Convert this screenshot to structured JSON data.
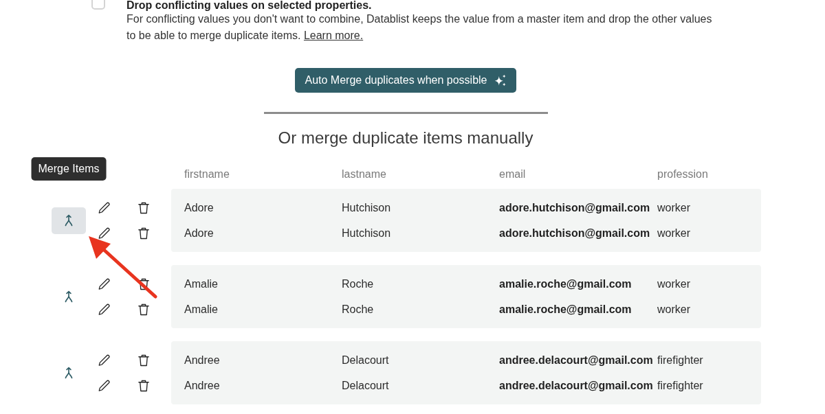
{
  "option": {
    "checked": false,
    "title": "Drop conflicting values on selected properties.",
    "description": "For conflicting values you don't want to combine, Datablist keeps the value from a master item and drop the other values to be able to merge duplicate items.",
    "link": "Learn more."
  },
  "auto_merge_button": {
    "label": "Auto Merge duplicates when possible"
  },
  "manual_heading": "Or merge duplicate items manually",
  "table": {
    "columns": [
      {
        "label": "firstname",
        "bold": false
      },
      {
        "label": "lastname",
        "bold": false
      },
      {
        "label": "email",
        "bold": true
      },
      {
        "label": "profession",
        "bold": false
      }
    ],
    "groups": [
      {
        "hovered": true,
        "tooltip": "Merge Items",
        "rows": [
          [
            "Adore",
            "Hutchison",
            "adore.hutchison@gmail.com",
            "worker"
          ],
          [
            "Adore",
            "Hutchison",
            "adore.hutchison@gmail.com",
            "worker"
          ]
        ]
      },
      {
        "hovered": false,
        "rows": [
          [
            "Amalie",
            "Roche",
            "amalie.roche@gmail.com",
            "worker"
          ],
          [
            "Amalie",
            "Roche",
            "amalie.roche@gmail.com",
            "worker"
          ]
        ]
      },
      {
        "hovered": false,
        "rows": [
          [
            "Andree",
            "Delacourt",
            "andree.delacourt@gmail.com",
            "firefighter"
          ],
          [
            "Andree",
            "Delacourt",
            "andree.delacourt@gmail.com",
            "firefighter"
          ]
        ]
      }
    ]
  },
  "annotations": [
    {
      "kind": "arrow"
    }
  ]
}
